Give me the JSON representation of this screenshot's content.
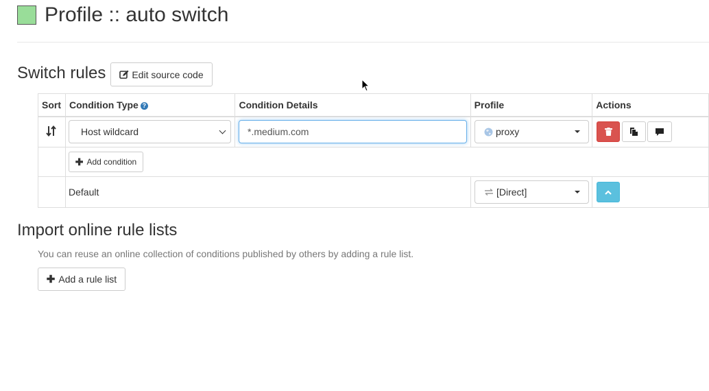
{
  "header": {
    "title": "Profile :: auto switch",
    "color": "#99dd99"
  },
  "switch_rules": {
    "title": "Switch rules",
    "edit_source_label": "Edit source code",
    "columns": {
      "sort": "Sort",
      "condition_type": "Condition Type",
      "condition_details": "Condition Details",
      "profile": "Profile",
      "actions": "Actions"
    },
    "rule": {
      "condition_type": "Host wildcard",
      "condition_details": "*.medium.com",
      "profile": "proxy"
    },
    "add_condition_label": "Add condition",
    "default_row": {
      "label": "Default",
      "profile": "[Direct]"
    }
  },
  "import": {
    "title": "Import online rule lists",
    "description": "You can reuse an online collection of conditions published by others by adding a rule list.",
    "add_rule_list_label": "Add a rule list"
  },
  "colors": {
    "delete": "#d9534f",
    "collapse": "#5bc0de",
    "focus": "#66afe9"
  }
}
